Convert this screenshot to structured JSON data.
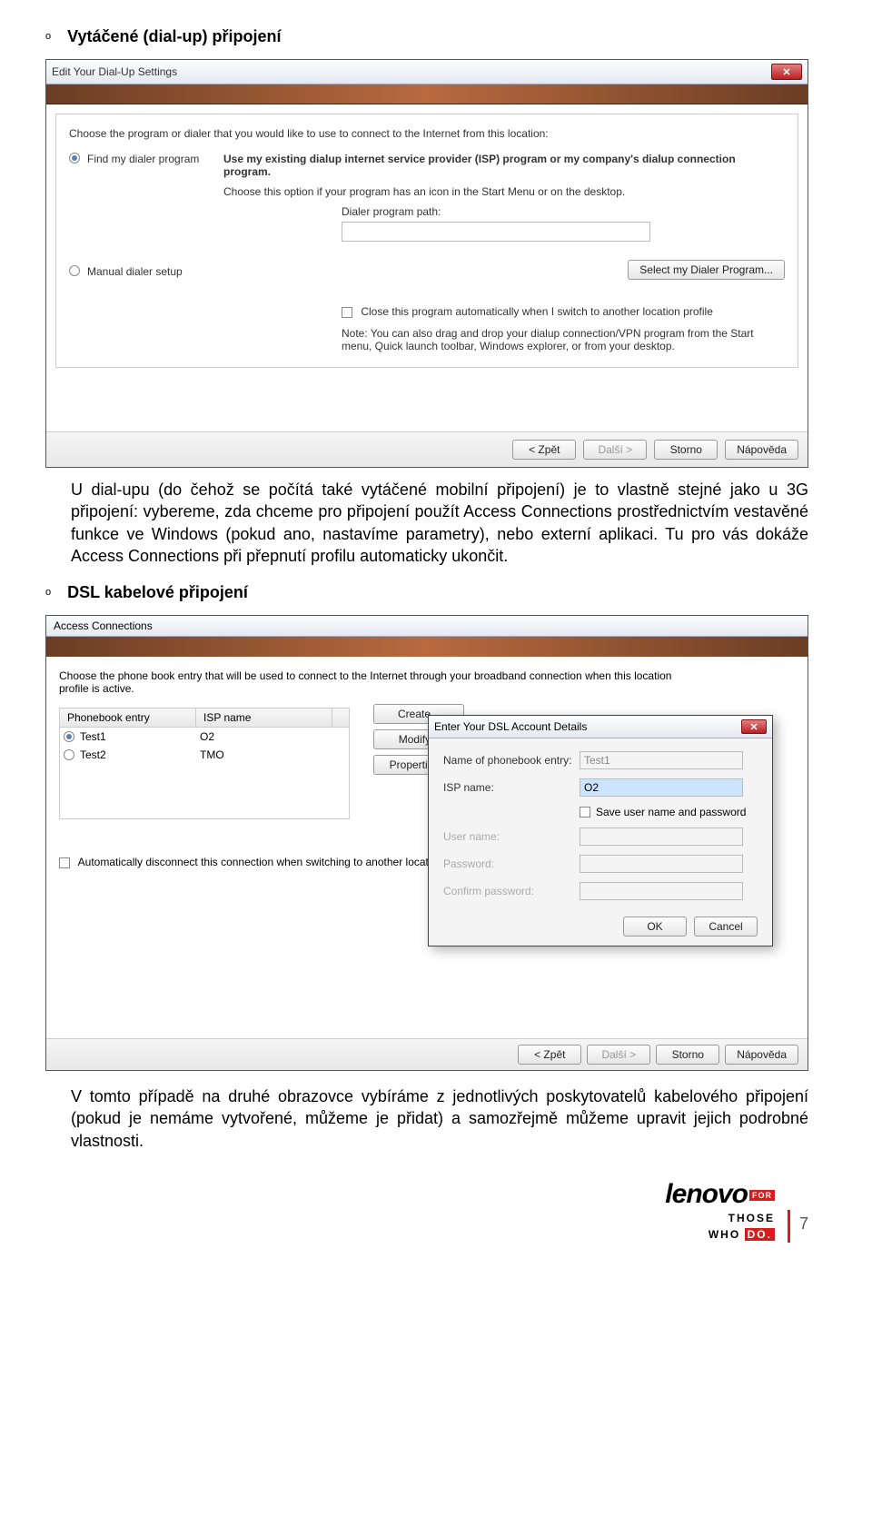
{
  "heading1": "Vytáčené (dial-up) připojení",
  "bulletMarker": "o",
  "dialog1": {
    "title": "Edit Your Dial-Up Settings",
    "instruction": "Choose the program or dialer that you would like to use to connect to the Internet from this location:",
    "opt1_label": "Find my dialer program",
    "opt1_bold": "Use my existing dialup internet service provider (ISP) program or my company's dialup connection program.",
    "opt1_desc": "Choose this option if your program has an icon in the Start Menu or on the desktop.",
    "dialer_path_label": "Dialer program path:",
    "select_btn": "Select my Dialer Program...",
    "opt2_label": "Manual dialer setup",
    "close_chk": "Close this program automatically when I switch to another location profile",
    "note": "Note: You can also drag and drop your dialup connection/VPN program from the Start menu, Quick launch toolbar, Windows explorer, or from your desktop.",
    "btn_back": "< Zpět",
    "btn_next": "Další >",
    "btn_cancel": "Storno",
    "btn_help": "Nápověda"
  },
  "para1": "U dial-upu (do čehož se počítá také vytáčené mobilní připojení) je to vlastně stejné jako u 3G připojení: vybereme, zda chceme pro připojení použít Access Connections prostřednictvím vestavěné funkce ve Windows (pokud ano, nastavíme parametry), nebo externí aplikaci. Tu pro vás dokáže Access Connections při přepnutí profilu automaticky ukončit.",
  "heading2": "DSL kabelové připojení",
  "dialog2": {
    "title": "Access Connections",
    "instruction": "Choose the phone book entry that will be used to connect to the Internet through your broadband connection when this location profile is active.",
    "col1": "Phonebook entry",
    "col2": "ISP name",
    "rows": [
      {
        "entry": "Test1",
        "isp": "O2",
        "selected": true
      },
      {
        "entry": "Test2",
        "isp": "TMO",
        "selected": false
      }
    ],
    "btn_create": "Create...",
    "btn_modify": "Modify...",
    "btn_props": "Properties...",
    "auto_disc": "Automatically disconnect this connection when switching to another location",
    "dsl": {
      "title": "Enter Your DSL Account Details",
      "l_name": "Name of phonebook entry:",
      "v_name": "Test1",
      "l_isp": "ISP name:",
      "v_isp": "O2",
      "save_chk": "Save user name and password",
      "l_user": "User name:",
      "l_pass": "Password:",
      "l_conf": "Confirm password:",
      "ok": "OK",
      "cancel": "Cancel"
    },
    "btn_back": "< Zpět",
    "btn_next": "Další >",
    "btn_cancel": "Storno",
    "btn_help": "Nápověda"
  },
  "para2": "V tomto případě na druhé obrazovce vybíráme z jednotlivých poskytovatelů kabelového připojení (pokud je nemáme vytvořené, můžeme je přidat) a samozřejmě můžeme upravit jejich podrobné vlastnosti.",
  "footer": {
    "brand": "lenovo",
    "for": "FOR",
    "those": "THOSE",
    "who": "WHO",
    "do": "DO.",
    "page": "7"
  }
}
